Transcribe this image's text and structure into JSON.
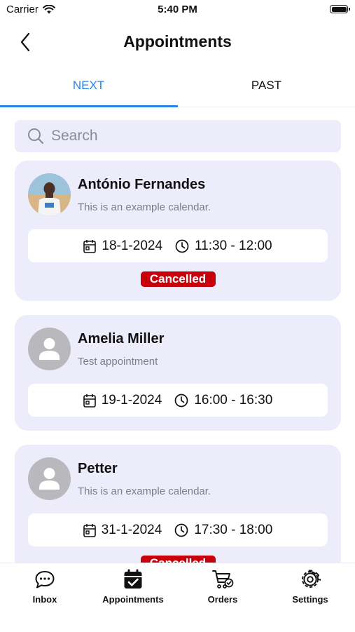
{
  "status_bar": {
    "carrier": "Carrier",
    "time": "5:40 PM"
  },
  "header": {
    "title": "Appointments"
  },
  "tabs": [
    {
      "label": "NEXT",
      "active": true
    },
    {
      "label": "PAST",
      "active": false
    }
  ],
  "search": {
    "placeholder": "Search"
  },
  "appointments": [
    {
      "name": "António Fernandes",
      "description": "This is an example calendar.",
      "date": "18-1-2024",
      "time": "11:30 - 12:00",
      "status": "Cancelled",
      "avatar": "photo"
    },
    {
      "name": "Amelia Miller",
      "description": "Test appointment",
      "date": "19-1-2024",
      "time": "16:00 - 16:30",
      "status": "",
      "avatar": "default-person-icon"
    },
    {
      "name": "Petter",
      "description": "This is an example calendar.",
      "date": "31-1-2024",
      "time": "17:30 - 18:00",
      "status": "Cancelled",
      "avatar": "default-person-icon"
    }
  ],
  "bottom_nav": [
    {
      "label": "Inbox",
      "icon": "chat-bubble-icon"
    },
    {
      "label": "Appointments",
      "icon": "calendar-check-icon",
      "active": true
    },
    {
      "label": "Orders",
      "icon": "cart-check-icon"
    },
    {
      "label": "Settings",
      "icon": "gear-icon"
    }
  ],
  "colors": {
    "accent": "#2b83e6",
    "card_bg": "#ececfb",
    "cancelled": "#c8000a"
  }
}
